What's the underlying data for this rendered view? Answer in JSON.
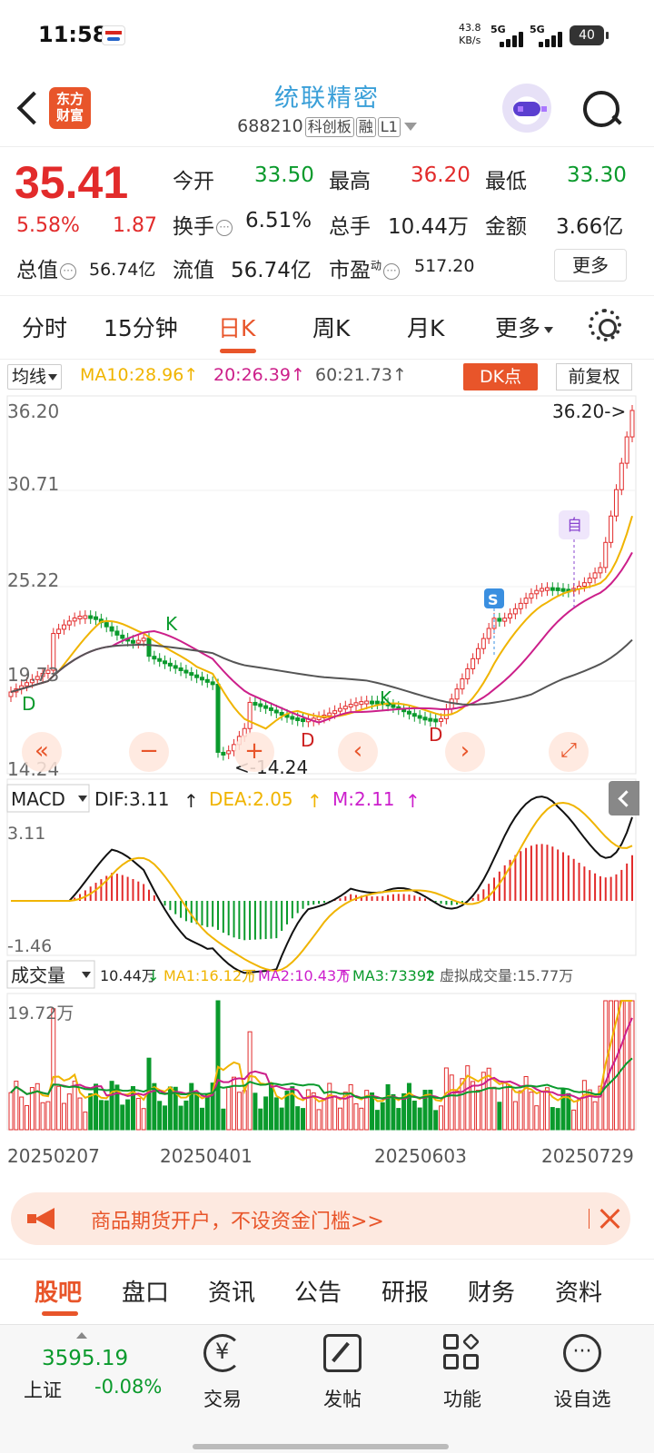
{
  "status_bar": {
    "time": "11:58",
    "speed_value": "43.8",
    "speed_unit": "KB/s",
    "network1": "5G",
    "network2": "5G",
    "battery": "40"
  },
  "header": {
    "logo_text_line1": "东方",
    "logo_text_line2": "财富",
    "stock_name": "统联精密",
    "stock_code": "688210",
    "tags": [
      "科创板",
      "融",
      "L1"
    ]
  },
  "quote": {
    "price": "35.41",
    "change_pct": "5.58%",
    "change_amt": "1.87",
    "open_label": "今开",
    "open_value": "33.50",
    "high_label": "最高",
    "high_value": "36.20",
    "low_label": "最低",
    "low_value": "33.30",
    "turnover_label": "换手",
    "turnover_value": "6.51%",
    "volume_label": "总手",
    "volume_value": "10.44万",
    "amount_label": "金额",
    "amount_value": "3.66亿",
    "mktcap_label": "总值",
    "mktcap_value": "56.74亿",
    "float_label": "流值",
    "float_value": "56.74亿",
    "pe_label": "市盈",
    "pe_sup": "动",
    "pe_value": "517.20",
    "more_label": "更多",
    "info_symbol": "···"
  },
  "period_tabs": {
    "items": [
      "分时",
      "15分钟",
      "日K",
      "周K",
      "月K",
      "更多"
    ],
    "active_index": 2
  },
  "ma_bar": {
    "selector": "均线",
    "ma10": "MA10:28.96",
    "ma20": "20:26.39",
    "ma60": "60:21.73",
    "arrow": "↑",
    "dk_button": "DK点",
    "adjust_button": "前复权"
  },
  "kline_chart": {
    "y_labels": [
      "36.20",
      "30.71",
      "25.22",
      "19.73",
      "14.24"
    ],
    "max_marker": "36.20->",
    "min_marker": "<-14.24",
    "markers": [
      "D",
      "K",
      "D",
      "K",
      "D"
    ],
    "s_badge": "S",
    "zi_badge": "自"
  },
  "macd": {
    "selector": "MACD",
    "dif": "DIF:3.11",
    "dea": "DEA:2.05",
    "m": "M:2.11",
    "arrow": "↑",
    "y_top": "3.11",
    "y_bottom": "-1.46"
  },
  "volume": {
    "selector": "成交量",
    "current": "10.44万",
    "down_arrow": "↓",
    "ma1": "MA1:16.12万",
    "ma2": "MA2:10.43万",
    "ma3": "MA3:73392",
    "up_arrow": "↑",
    "virtual": "虚拟成交量:15.77万",
    "y_top": "19.72万"
  },
  "dates": [
    "20250207",
    "20250401",
    "20250603",
    "20250729"
  ],
  "ad": {
    "text": "商品期货开户，不设资金门槛>>"
  },
  "section_tabs": {
    "items": [
      "股吧",
      "盘口",
      "资讯",
      "公告",
      "研报",
      "财务",
      "资料"
    ],
    "active_index": 0
  },
  "bottom_nav": {
    "index_value": "3595.19",
    "index_name": "上证",
    "index_change": "-0.08%",
    "items": [
      "交易",
      "发帖",
      "功能",
      "设自选"
    ]
  },
  "colors": {
    "accent": "#e8552a",
    "up": "#e22b2b",
    "down": "#0a9a2c",
    "ma10": "#f0b400",
    "ma20": "#cc1f8a",
    "ma60": "#555555"
  }
}
